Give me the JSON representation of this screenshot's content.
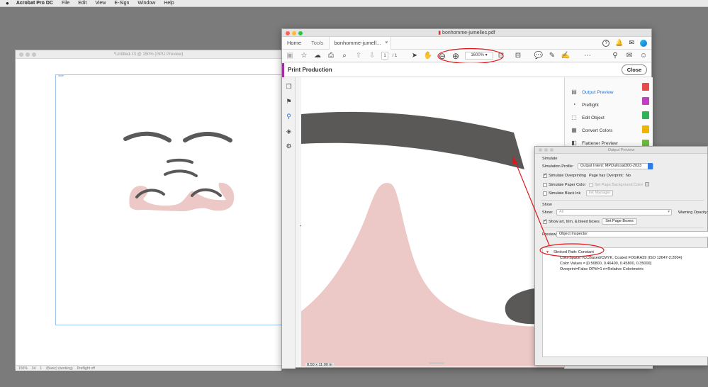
{
  "menubar": {
    "apple": "",
    "app_name": "Acrobat Pro DC",
    "items": [
      "File",
      "Edit",
      "View",
      "E-Sign",
      "Window",
      "Help"
    ]
  },
  "illustrator": {
    "title": "*Untitled-13 @ 150% (GPU Preview)",
    "status": [
      "150%",
      "34",
      "1",
      "(Basic) (working)",
      "Preflight off"
    ]
  },
  "acrobat": {
    "title": "bonhomme-jumelles.pdf",
    "tabs": {
      "home": "Home",
      "tools": "Tools",
      "document": "bonhomme-jumell...",
      "close": "×"
    },
    "toolbar": {
      "page_current": "1",
      "page_total": "/ 1",
      "zoom": "1600%"
    },
    "print_production": {
      "title": "Print Production",
      "close_label": "Close"
    },
    "tools_list": [
      "Output Preview",
      "Preflight",
      "Edit Object",
      "Convert Colors",
      "Flattener Preview"
    ],
    "page_size": "8.50 x 11.00 in"
  },
  "output_preview": {
    "title": "Output Preview",
    "simulate_header": "Simulate",
    "sim_profile_label": "Simulation Profile:",
    "sim_profile_value": "Output Intent: MPDullcoat300-2023",
    "sim_overprinting": "Simulate Overprinting",
    "page_overprint_label": "Page has Overprint:",
    "page_overprint_value": "No",
    "sim_paper": "Simulate Paper Color",
    "set_page_bg": "Set Page Background Color",
    "sim_black_ink": "Simulate Black Ink",
    "ink_manager": "Ink Manager",
    "show_header": "Show",
    "show_label": "Show:",
    "show_value": "All",
    "warning_opacity": "Warning Opacity:",
    "show_boxes": "Show art, trim, & bleed boxes",
    "set_page_boxes": "Set Page Boxes",
    "preview_label": "Preview:",
    "preview_value": "Object Inspector",
    "inspector": {
      "heading": "Stroked Path: Constant",
      "colorspace": "ColorSpace: ICCBased/CMYK, Coated FOGRA39 (ISO 12647-2:2004)",
      "color_values": "Color Values = [0.56800, 0.46400, 0.45800, 0.35000]",
      "overprint": "Overprint=False OPM=1 ri=Relative Colorimetric"
    }
  },
  "colors": {
    "annotation_red": "#e0181e",
    "brow_gray": "#5a5957",
    "skin_pink": "#ecc8c6",
    "accent_blue": "#1473e6",
    "print_production_purple": "#a62aa6"
  }
}
